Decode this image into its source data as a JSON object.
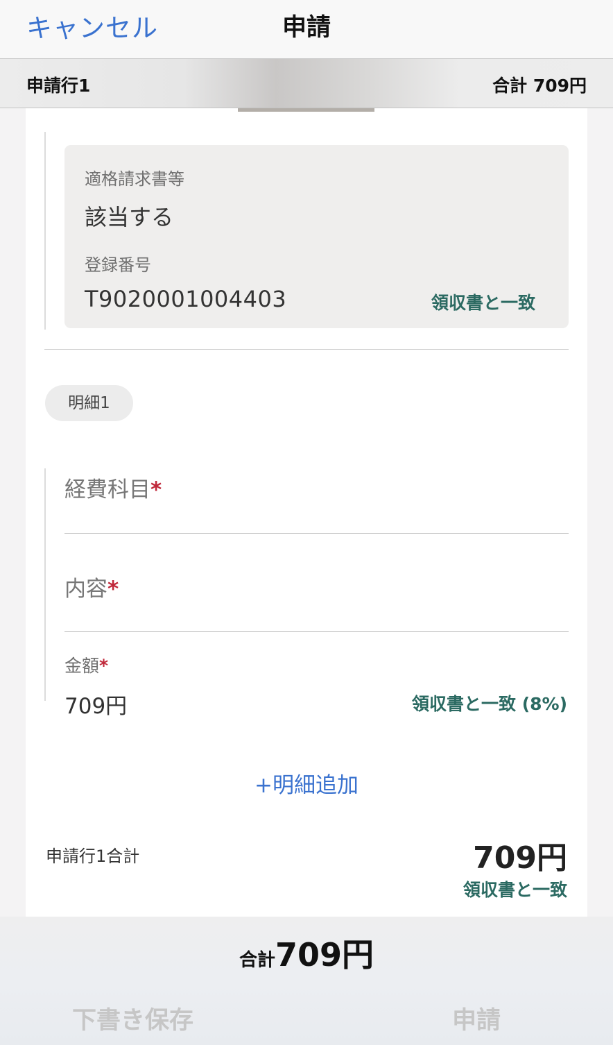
{
  "nav": {
    "cancel_label": "キャンセル",
    "title": "申請"
  },
  "line_header": {
    "title": "申請行1",
    "total": "合計 709円"
  },
  "invoice": {
    "qualified_label": "適格請求書等",
    "qualified_value": "該当する",
    "reg_label": "登録番号",
    "reg_value": "T9020001004403",
    "match_status": "領収書と一致"
  },
  "detail": {
    "badge": "明細1",
    "account_label": "経費科目",
    "content_label": "内容",
    "amount_label": "金額",
    "required_mark": "*",
    "amount_value": "709円",
    "amount_status": "領収書と一致 (8%)",
    "add_label": "+明細追加"
  },
  "line_summary": {
    "label": "申請行1合計",
    "value": "709円",
    "status": "領収書と一致"
  },
  "footer": {
    "total_label": "合計",
    "total_value": "709円",
    "draft_label": "下書き保存",
    "submit_label": "申請"
  },
  "colors": {
    "accent": "#3a72cf",
    "match_green": "#2b6a62",
    "required_red": "#c0283a"
  }
}
